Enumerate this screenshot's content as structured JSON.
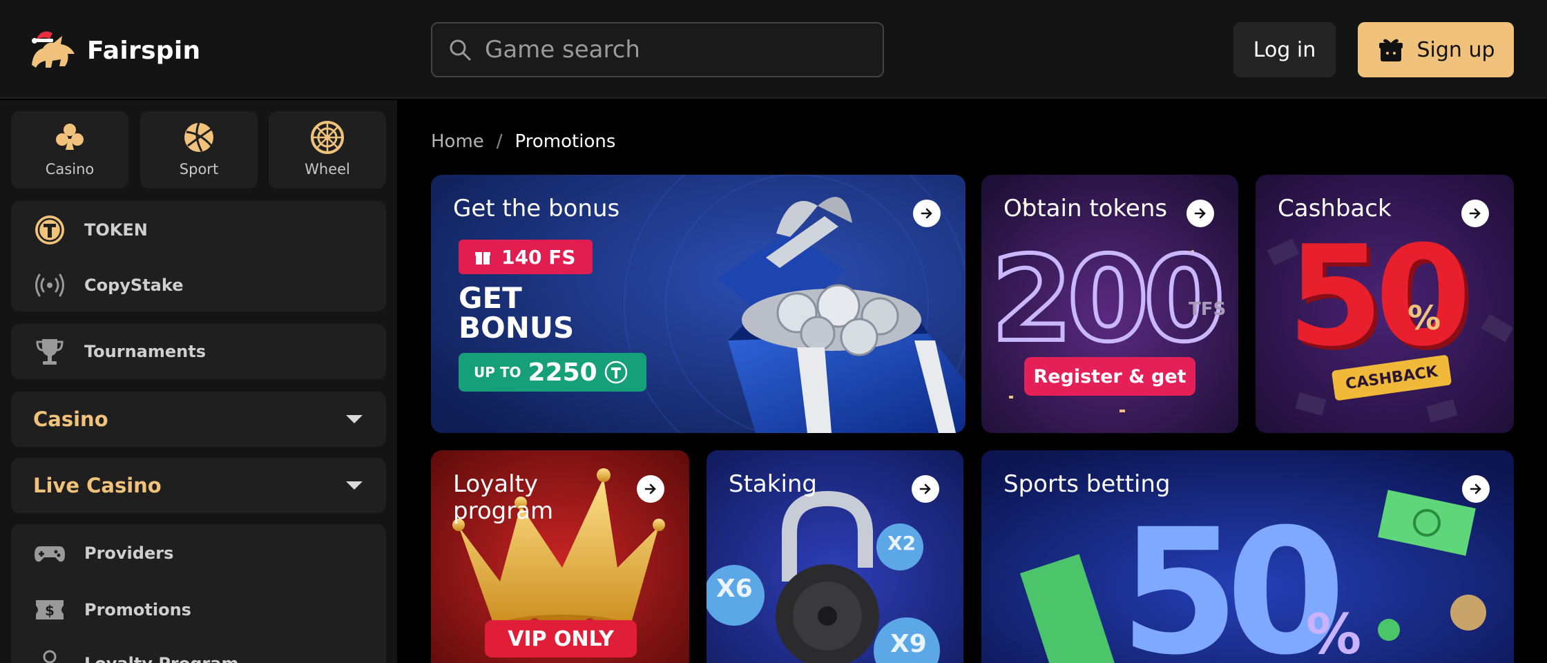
{
  "brand": {
    "name": "Fairspin"
  },
  "search": {
    "placeholder": "Game search"
  },
  "auth": {
    "login_label": "Log in",
    "signup_label": "Sign up"
  },
  "quick_links": [
    {
      "label": "Casino",
      "icon": "clubs-icon"
    },
    {
      "label": "Sport",
      "icon": "volleyball-icon"
    },
    {
      "label": "Wheel",
      "icon": "wheel-icon"
    }
  ],
  "sidebar": {
    "group1": [
      {
        "label": "TOKEN",
        "icon": "token-icon"
      },
      {
        "label": "CopyStake",
        "icon": "broadcast-icon"
      }
    ],
    "tournaments": {
      "label": "Tournaments",
      "icon": "trophy-icon"
    },
    "casino_dropdown": "Casino",
    "live_casino_dropdown": "Live Casino",
    "group2": [
      {
        "label": "Providers",
        "icon": "gamepad-icon"
      },
      {
        "label": "Promotions",
        "icon": "dollar-ticket-icon"
      },
      {
        "label": "Loyalty Program",
        "icon": "loyalty-icon"
      }
    ]
  },
  "breadcrumb": {
    "home": "Home",
    "separator": "/",
    "current": "Promotions"
  },
  "promotions": [
    {
      "title": "Get the bonus",
      "fs_badge": "140 FS",
      "headline_1": "GET",
      "headline_2": "BONUS",
      "upto_prefix": "UP TO",
      "upto_value": "2250"
    },
    {
      "title": "Obtain tokens",
      "big_number": "200",
      "suffix": "TFS",
      "button_text": "Register & get"
    },
    {
      "title": "Cashback",
      "big_number": "50",
      "percent": "%",
      "ribbon": "CASHBACK"
    },
    {
      "title": "Loyalty program",
      "ribbon": "VIP ONLY"
    },
    {
      "title": "Staking",
      "coin_1": "X6",
      "coin_2": "X2",
      "coin_3": "X9"
    },
    {
      "title": "Sports betting",
      "big_number": "50",
      "percent": "%"
    }
  ],
  "colors": {
    "accent": "#f0c27b",
    "background": "#000000",
    "panel": "#141414",
    "tile": "#1f1f1f"
  }
}
